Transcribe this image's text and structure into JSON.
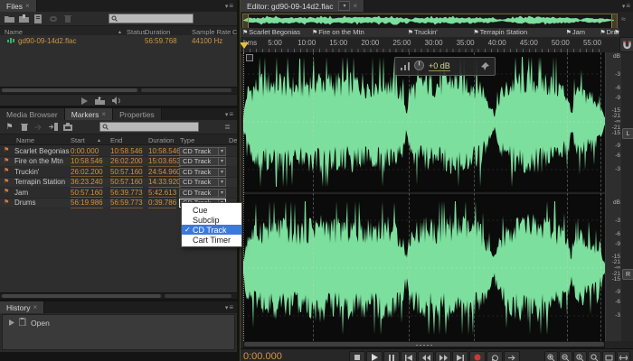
{
  "colors": {
    "accent_orange": "#d3973f",
    "waveform_green": "#7cdf9d",
    "selection_blue": "#3b79dd",
    "wave_bg": "#0b0b0b"
  },
  "files_panel": {
    "tab": "Files",
    "close_glyph": "×",
    "columns": {
      "name": "Name",
      "sort": "▴",
      "status": "Status",
      "duration": "Duration",
      "sample_rate": "Sample Rate",
      "extra": "C"
    },
    "rows": [
      {
        "name": "gd90-09-14d2.flac",
        "duration": "56:59.768",
        "sample_rate": "44100 Hz"
      }
    ]
  },
  "markers_panel": {
    "tabs": [
      {
        "label": "Media Browser"
      },
      {
        "label": "Markers"
      },
      {
        "label": "Properties"
      }
    ],
    "close_glyph": "×",
    "columns": {
      "name": "Name",
      "start": "Start",
      "sort": "▴",
      "end": "End",
      "duration": "Duration",
      "type": "Type",
      "extra": "De"
    },
    "rows": [
      {
        "name": "Scarlet Begonias",
        "start": "0:00.000",
        "end": "10:58.546",
        "duration": "10:58.546",
        "type": "CD Track",
        "selected": false
      },
      {
        "name": "Fire on the Mtn",
        "start": "10:58.546",
        "end": "26:02.200",
        "duration": "15:03.653",
        "type": "CD Track",
        "selected": false
      },
      {
        "name": "Truckin'",
        "start": "26:02.200",
        "end": "50:57.160",
        "duration": "24:54.960",
        "type": "CD Track",
        "selected": false
      },
      {
        "name": "Terrapin Station",
        "start": "36:23.240",
        "end": "50:57.160",
        "duration": "14:33.920",
        "type": "CD Track",
        "selected": false
      },
      {
        "name": "Jam",
        "start": "50:57.160",
        "end": "56:39.773",
        "duration": "5:42.613",
        "type": "CD Track",
        "selected": false
      },
      {
        "name": "Drums",
        "start": "56:19.986",
        "end": "56:59.773",
        "duration": "0:39.786",
        "type": "CD Track",
        "selected": true
      }
    ]
  },
  "type_menu": {
    "items": [
      {
        "label": "Cue",
        "checked": false
      },
      {
        "label": "Subclip",
        "checked": false
      },
      {
        "label": "CD Track",
        "checked": true
      },
      {
        "label": "Cart Timer",
        "checked": false
      }
    ]
  },
  "history_panel": {
    "tab": "History",
    "close_glyph": "×",
    "items": [
      {
        "label": "Open"
      }
    ]
  },
  "editor": {
    "tab": "Editor: gd90-09-14d2.flac",
    "close_glyph": "×",
    "ruler_unit": "hms",
    "ruler_ticks": [
      "5:00",
      "10:00",
      "15:00",
      "20:00",
      "25:00",
      "30:00",
      "35:00",
      "40:00",
      "45:00",
      "50:00",
      "55:00"
    ],
    "total_seconds": 3420,
    "hud_gain": "+0 dB",
    "db_top_label": "dB",
    "db_values": [
      3,
      6,
      9,
      15,
      21
    ],
    "db_infinity": "-∞",
    "channels": [
      "L",
      "R"
    ],
    "transport_time": "0:00.000",
    "waveform_envelope": [
      [
        0,
        0.1
      ],
      [
        0.01,
        0.6
      ],
      [
        0.05,
        0.8
      ],
      [
        0.1,
        0.82
      ],
      [
        0.15,
        0.72
      ],
      [
        0.2,
        0.88
      ],
      [
        0.25,
        0.8
      ],
      [
        0.3,
        0.82
      ],
      [
        0.35,
        0.78
      ],
      [
        0.4,
        0.85
      ],
      [
        0.44,
        0.6
      ],
      [
        0.452,
        0.18
      ],
      [
        0.46,
        0.65
      ],
      [
        0.5,
        0.82
      ],
      [
        0.54,
        0.78
      ],
      [
        0.58,
        0.88
      ],
      [
        0.62,
        0.8
      ],
      [
        0.655,
        0.75
      ],
      [
        0.68,
        0.4
      ],
      [
        0.695,
        0.15
      ],
      [
        0.71,
        0.55
      ],
      [
        0.75,
        0.82
      ],
      [
        0.8,
        0.88
      ],
      [
        0.85,
        0.8
      ],
      [
        0.875,
        0.72
      ],
      [
        0.9,
        0.5
      ],
      [
        0.906,
        0.12
      ],
      [
        0.915,
        0.5
      ],
      [
        0.93,
        0.62
      ],
      [
        0.95,
        0.55
      ],
      [
        0.97,
        0.5
      ],
      [
        0.99,
        0.25
      ],
      [
        1,
        0.08
      ]
    ]
  }
}
